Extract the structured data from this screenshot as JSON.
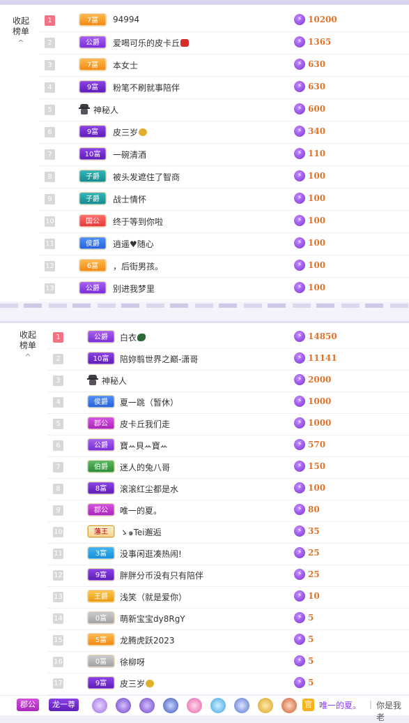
{
  "colors": {
    "accent": "#8a3ff0",
    "score": "#e0722a",
    "rank_top": "#f07284"
  },
  "panel1": {
    "collapse_label_1": "收起",
    "collapse_label_2": "榜单",
    "chevron": "^",
    "rows": [
      {
        "rank": "1",
        "badge": "7富",
        "badge_style": "orange",
        "name": "94994",
        "emoji": "",
        "score": "10200"
      },
      {
        "rank": "2",
        "badge": "公爵",
        "badge_style": "purple",
        "name": "爱喝可乐的皮卡丘",
        "emoji": "car",
        "score": "1365"
      },
      {
        "rank": "3",
        "badge": "7富",
        "badge_style": "orange",
        "name": "本女士",
        "emoji": "",
        "score": "630"
      },
      {
        "rank": "4",
        "badge": "9富",
        "badge_style": "darkpurple",
        "name": "粉笔不刷就事陪伴",
        "emoji": "",
        "score": "630"
      },
      {
        "rank": "5",
        "badge": "",
        "badge_style": "spy",
        "name": "神秘人",
        "emoji": "",
        "score": "600"
      },
      {
        "rank": "6",
        "badge": "9富",
        "badge_style": "darkpurple",
        "name": "皮三岁",
        "emoji": "bag",
        "score": "340"
      },
      {
        "rank": "7",
        "badge": "10富",
        "badge_style": "darkpurple",
        "name": "一碗清酒",
        "emoji": "",
        "score": "110"
      },
      {
        "rank": "8",
        "badge": "子爵",
        "badge_style": "teal",
        "name": "被头发遮住了智商",
        "emoji": "",
        "score": "100"
      },
      {
        "rank": "9",
        "badge": "子爵",
        "badge_style": "teal",
        "name": "战士情怀",
        "emoji": "",
        "score": "100"
      },
      {
        "rank": "10",
        "badge": "国公",
        "badge_style": "red",
        "name": "终于等到你啦",
        "emoji": "",
        "score": "100"
      },
      {
        "rank": "11",
        "badge": "侯爵",
        "badge_style": "blue",
        "name": "逍遥♥随心",
        "emoji": "",
        "score": "100"
      },
      {
        "rank": "12",
        "badge": "6富",
        "badge_style": "orange",
        "name": "，后街男孩。",
        "emoji": "",
        "score": "100"
      },
      {
        "rank": "13",
        "badge": "公爵",
        "badge_style": "purple",
        "name": "别进我梦里",
        "emoji": "",
        "score": "100"
      }
    ]
  },
  "panel2": {
    "collapse_label_1": "收起",
    "collapse_label_2": "榜单",
    "chevron": "^",
    "rows": [
      {
        "rank": "1",
        "badge": "公爵",
        "badge_style": "purple",
        "name": "白衣",
        "emoji": "bird",
        "score": "14850"
      },
      {
        "rank": "2",
        "badge": "10富",
        "badge_style": "darkpurple",
        "name": "陪妳翦世界之巅-潇哥",
        "emoji": "",
        "score": "11141"
      },
      {
        "rank": "3",
        "badge": "",
        "badge_style": "spy",
        "name": "神秘人",
        "emoji": "",
        "score": "2000"
      },
      {
        "rank": "4",
        "badge": "侯爵",
        "badge_style": "blue",
        "name": "夏一跳（暂休）",
        "emoji": "",
        "score": "1000"
      },
      {
        "rank": "5",
        "badge": "郡公",
        "badge_style": "magenta",
        "name": "皮卡丘我们走",
        "emoji": "",
        "score": "1000"
      },
      {
        "rank": "6",
        "badge": "公爵",
        "badge_style": "purple",
        "name": "寶ꕀ貝ꕀ寶ꕀ",
        "emoji": "",
        "score": "570"
      },
      {
        "rank": "7",
        "badge": "伯爵",
        "badge_style": "green",
        "name": "迷人的兔八哥",
        "emoji": "",
        "score": "150"
      },
      {
        "rank": "8",
        "badge": "8富",
        "badge_style": "darkpurple",
        "name": "滚滚红尘都是水",
        "emoji": "",
        "score": "100"
      },
      {
        "rank": "9",
        "badge": "郡公",
        "badge_style": "magenta",
        "name": "唯一的夏。",
        "emoji": "",
        "score": "80"
      },
      {
        "rank": "10",
        "badge": "藩王",
        "badge_style": "king",
        "name": "ゝ๑Tei邂逅",
        "emoji": "",
        "score": "35"
      },
      {
        "rank": "11",
        "badge": "3富",
        "badge_style": "skyblue",
        "name": "没事闲逛凑热闹!",
        "emoji": "",
        "score": "25"
      },
      {
        "rank": "12",
        "badge": "9富",
        "badge_style": "darkpurple",
        "name": "胖胖分币没有只有陪伴",
        "emoji": "",
        "score": "25"
      },
      {
        "rank": "13",
        "badge": "王爵",
        "badge_style": "gold",
        "name": "浅笑（就是爱你）",
        "emoji": "",
        "score": "10"
      },
      {
        "rank": "14",
        "badge": "0富",
        "badge_style": "gray",
        "name": "萌新宝宝dy8RgY",
        "emoji": "",
        "score": "5"
      },
      {
        "rank": "15",
        "badge": "5富",
        "badge_style": "orange",
        "name": "龙腾虎跃2023",
        "emoji": "",
        "score": "5"
      },
      {
        "rank": "16",
        "badge": "0富",
        "badge_style": "gray",
        "name": "徐柳呀",
        "emoji": "",
        "score": "5"
      },
      {
        "rank": "17",
        "badge": "9富",
        "badge_style": "darkpurple",
        "name": "皮三岁",
        "emoji": "bag",
        "score": "5"
      }
    ]
  },
  "bottom_bar": {
    "badge1": "郡公",
    "badge2": "龙一尊",
    "tag": "官",
    "username": "唯一的夏。",
    "message": "你是我老"
  }
}
